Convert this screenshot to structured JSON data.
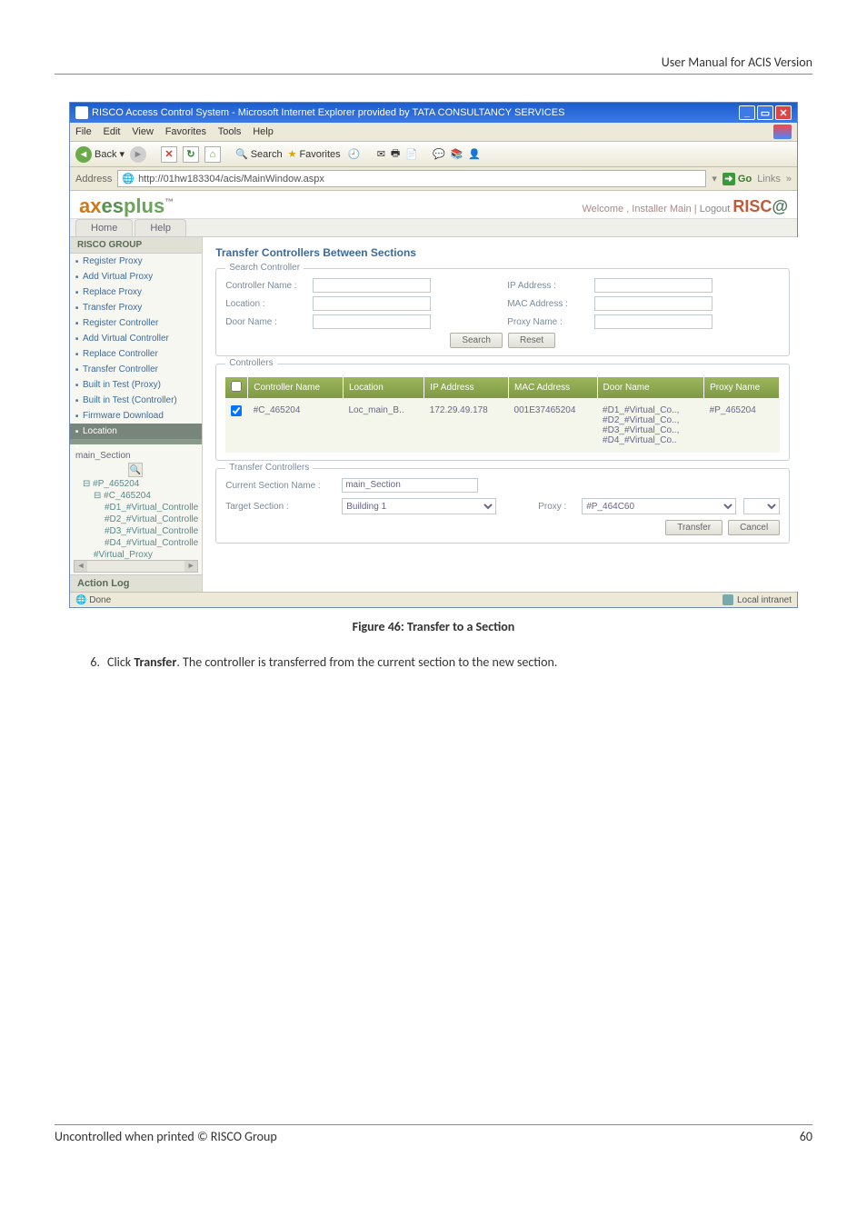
{
  "doc": {
    "header": "User Manual for ACIS Version",
    "figure_caption": "Figure 46: Transfer to a Section",
    "step_num": "6.",
    "step_text_a": "Click ",
    "step_text_bold": "Transfer",
    "step_text_b": ". The controller is transferred from the current section to the new section.",
    "footer_left": "Uncontrolled when printed © RISCO Group",
    "footer_right": "60"
  },
  "ie": {
    "title": "RISCO Access Control System - Microsoft Internet Explorer provided by TATA CONSULTANCY SERVICES",
    "menu": {
      "file": "File",
      "edit": "Edit",
      "view": "View",
      "favorites": "Favorites",
      "tools": "Tools",
      "help": "Help"
    },
    "toolbar": {
      "back": "Back",
      "search": "Search",
      "favorites": "Favorites"
    },
    "addressbar": {
      "label": "Address",
      "url": "http://01hw183304/acis/MainWindow.aspx",
      "go": "Go",
      "links": "Links"
    },
    "status": {
      "done": "Done",
      "zone": "Local intranet"
    }
  },
  "app": {
    "brand_a": "ax",
    "brand_b": "es",
    "brand_c": "plus",
    "brand_tm": "™",
    "welcome": "Welcome ,  Installer Main  |  ",
    "logout": "Logout",
    "risco_a": "RISC",
    "risco_b": "@",
    "tabs": {
      "home": "Home",
      "help": "Help"
    }
  },
  "sidebar": {
    "group": "RISCO GROUP",
    "items": {
      "register_proxy": "Register Proxy",
      "add_virtual_proxy": "Add Virtual Proxy",
      "replace_proxy": "Replace Proxy",
      "transfer_proxy": "Transfer Proxy",
      "register_controller": "Register Controller",
      "add_virtual_controller": "Add Virtual Controller",
      "replace_controller": "Replace Controller",
      "transfer_controller": "Transfer Controller",
      "bit_proxy": "Built in Test (Proxy)",
      "bit_controller": "Built in Test (Controller)",
      "firmware": "Firmware Download",
      "location": "Location",
      "blank": " "
    },
    "tree": {
      "main": "main_Section",
      "p": "#P_465204",
      "c": "#C_465204",
      "d1": "#D1_#Virtual_Controlle",
      "d2": "#D2_#Virtual_Controlle",
      "d3": "#D3_#Virtual_Controlle",
      "d4": "#D4_#Virtual_Controlle",
      "vproxy": "#Virtual_Proxy"
    },
    "action_log": "Action Log"
  },
  "panel": {
    "title": "Transfer Controllers Between Sections",
    "search": {
      "legend": "Search Controller",
      "controller_name": "Controller Name :",
      "location": "Location :",
      "door_name": "Door Name :",
      "ip": "IP Address :",
      "mac": "MAC Address :",
      "proxy_name": "Proxy Name :",
      "search_btn": "Search",
      "reset_btn": "Reset"
    },
    "controllers": {
      "legend": "Controllers",
      "headers": {
        "chk": "",
        "name": "Controller Name",
        "loc": "Location",
        "ip": "IP Address",
        "mac": "MAC Address",
        "door": "Door Name",
        "proxy": "Proxy Name"
      },
      "row": {
        "name": "#C_465204",
        "loc": "Loc_main_B..",
        "ip": "172.29.49.178",
        "mac": "001E37465204",
        "door": "#D1_#Virtual_Co..,\n#D2_#Virtual_Co..,\n#D3_#Virtual_Co..,\n#D4_#Virtual_Co..",
        "proxy": "#P_465204"
      }
    },
    "transfer": {
      "legend": "Transfer Controllers",
      "current": "Current Section Name :",
      "current_val": "main_Section",
      "target": "Target Section :",
      "target_val": "Building 1",
      "proxy": "Proxy :",
      "proxy_val": "#P_464C60",
      "transfer_btn": "Transfer",
      "cancel_btn": "Cancel"
    }
  }
}
